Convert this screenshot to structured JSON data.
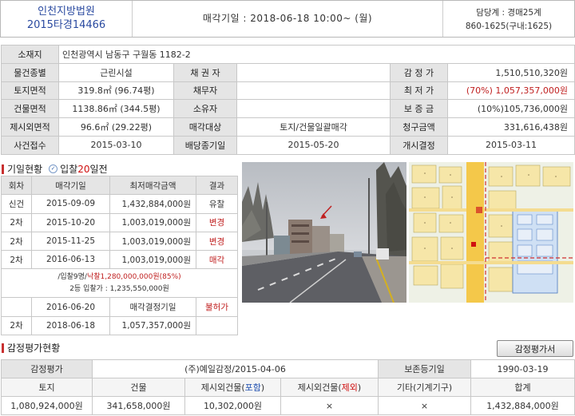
{
  "header": {
    "court": "인천지방법원",
    "case_no": "2015타경14466",
    "sale_date": "매각기일 : 2018-06-18   10:00~ (월)",
    "manager": "담당계 : 경매25계",
    "phone": "860-1625(구내:1625)"
  },
  "info": {
    "address_label": "소재지",
    "address": "인천광역시 남동구 구월동 1182-2",
    "rows": [
      {
        "l1": "물건종별",
        "v1": "근린시설",
        "l2": "채 권 자",
        "v2": "",
        "l3": "감 정 가",
        "v3": "1,510,510,320원"
      },
      {
        "l1": "토지면적",
        "v1": "319.8㎡ (96.74평)",
        "l2": "채무자",
        "v2": "",
        "l3": "최 저 가",
        "v3": "(70%) 1,057,357,000원"
      },
      {
        "l1": "건물면적",
        "v1": "1138.86㎡ (344.5평)",
        "l2": "소유자",
        "v2": "",
        "l3": "보 증 금",
        "v3": "(10%)105,736,000원"
      },
      {
        "l1": "제시외면적",
        "v1": "96.6㎡ (29.22평)",
        "l2": "매각대상",
        "v2": "토지/건물일괄매각",
        "l3": "청구금액",
        "v3": "331,616,438원"
      },
      {
        "l1": "사건접수",
        "v1": "2015-03-10",
        "l2": "배당종기일",
        "v2": "2015-05-20",
        "l3": "개시결정",
        "v3": "2015-03-11"
      }
    ]
  },
  "history": {
    "title": "기일현황",
    "badge_pre": "입찰",
    "badge_num": "20",
    "badge_post": "일전",
    "headers": [
      "회차",
      "매각기일",
      "최저매각금액",
      "결과"
    ],
    "rows": [
      {
        "round": "신건",
        "date": "2015-09-09",
        "price": "1,432,884,000원",
        "result": "유찰"
      },
      {
        "round": "2차",
        "date": "2015-10-20",
        "price": "1,003,019,000원",
        "result": "변경"
      },
      {
        "round": "2차",
        "date": "2015-11-25",
        "price": "1,003,019,000원",
        "result": "변경"
      },
      {
        "round": "2차",
        "date": "2016-06-13",
        "price": "1,003,019,000원",
        "result": "매각"
      }
    ],
    "note_bidders": "/입찰9명/",
    "note_winning": "낙찰1,280,000,000원(85%)",
    "note_second": "2등 입찰가 : 1,235,550,000원",
    "decision_date": "2016-06-20",
    "decision_label": "매각결정기일",
    "decision_result": "불허가",
    "last_row": {
      "round": "2차",
      "date": "2018-06-18",
      "price": "1,057,357,000원",
      "result": ""
    }
  },
  "appraisal": {
    "title": "감정평가현황",
    "button": "감정평가서",
    "label": "감정평가",
    "agency": "(주)예일감정/2015-04-06",
    "reg_label": "보존등기일",
    "reg_date": "1990-03-19",
    "cols": [
      {
        "pre": "토지",
        "mark": "",
        "post": ""
      },
      {
        "pre": "건물",
        "mark": "",
        "post": ""
      },
      {
        "pre": "제시외건물(",
        "mark": "포함",
        "post": ")"
      },
      {
        "pre": "제시외건물(",
        "mark": "제외",
        "post": ")"
      },
      {
        "pre": "기타(기계기구)",
        "mark": "",
        "post": ""
      },
      {
        "pre": "합계",
        "mark": "",
        "post": ""
      }
    ],
    "values": [
      "1,080,924,000원",
      "341,658,000원",
      "10,302,000원",
      "×",
      "×",
      "1,432,884,000원"
    ]
  },
  "colors": {
    "accent_red": "#c83030",
    "link_blue": "#2a4aa0",
    "header_gray": "#e5e5e5"
  }
}
